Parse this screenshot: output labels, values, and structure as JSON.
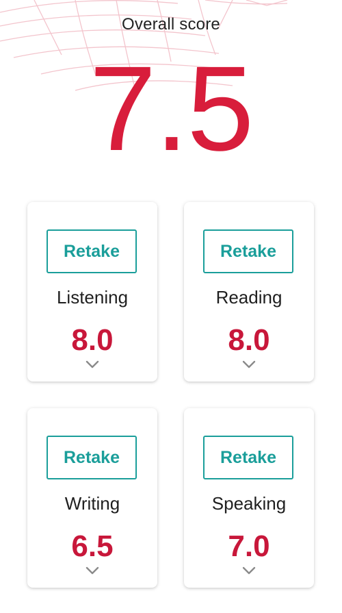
{
  "overall": {
    "label": "Overall score",
    "value": "7.5"
  },
  "skills": [
    {
      "name": "Listening",
      "score": "8.0",
      "retake_label": "Retake",
      "expand_icon": "chevron-down-icon"
    },
    {
      "name": "Reading",
      "score": "8.0",
      "retake_label": "Retake",
      "expand_icon": "chevron-down-icon"
    },
    {
      "name": "Writing",
      "score": "6.5",
      "retake_label": "Retake",
      "expand_icon": "chevron-down-icon"
    },
    {
      "name": "Speaking",
      "score": "7.0",
      "retake_label": "Retake",
      "expand_icon": "chevron-down-icon"
    }
  ],
  "colors": {
    "score_red": "#d81d3b",
    "accent_teal": "#1a9e9a",
    "text_dark": "#222222",
    "chevron_gray": "#8a8a8a"
  }
}
